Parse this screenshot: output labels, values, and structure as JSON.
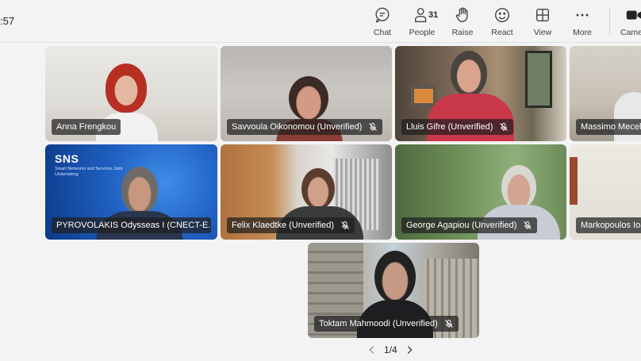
{
  "header": {
    "clock": ":57",
    "tools": [
      {
        "id": "chat",
        "label": "Chat",
        "icon": "chat-icon"
      },
      {
        "id": "people",
        "label": "People",
        "icon": "people-icon",
        "count": "31"
      },
      {
        "id": "raise",
        "label": "Raise",
        "icon": "raise-hand-icon"
      },
      {
        "id": "react",
        "label": "React",
        "icon": "react-icon"
      },
      {
        "id": "view",
        "label": "View",
        "icon": "view-icon"
      },
      {
        "id": "more",
        "label": "More",
        "icon": "more-icon"
      },
      {
        "id": "camera",
        "label": "Camera",
        "icon": "camera-icon"
      }
    ]
  },
  "participants": [
    {
      "name": "Anna Frengkou",
      "muted": false
    },
    {
      "name": "Savvoula Oikonomou (Unverified)",
      "muted": true
    },
    {
      "name": "Lluis Gifre (Unverified)",
      "muted": true
    },
    {
      "name": "Massimo Mecella",
      "muted": false
    },
    {
      "name": "PYROVOLAKIS Odysseas I (CNECT-E...",
      "muted": false
    },
    {
      "name": "Felix Klaedtke (Unverified)",
      "muted": true
    },
    {
      "name": "George Agapiou (Unverified)",
      "muted": true
    },
    {
      "name": "Markopoulos Ioa",
      "muted": false
    },
    {
      "name": "Toktam Mahmoodi (Unverified)",
      "muted": true
    }
  ],
  "sns_logo": {
    "text": "SNS",
    "subtitle": "Smart Networks and Services Joint Undertaking"
  },
  "pagination": {
    "label": "1/4"
  }
}
